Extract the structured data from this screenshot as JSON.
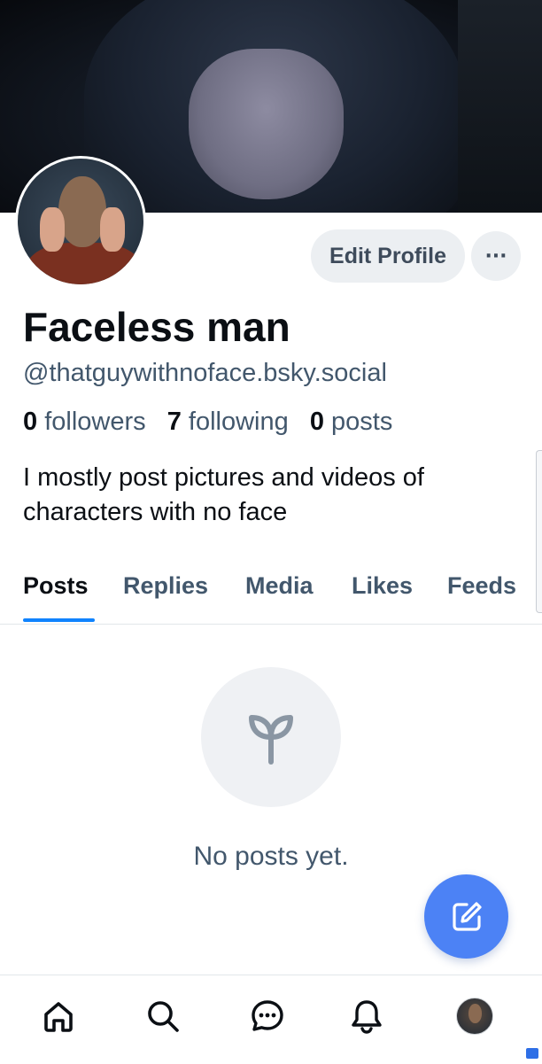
{
  "profile": {
    "display_name": "Faceless man",
    "handle": "@thatguywithnoface.bsky.social",
    "stats": {
      "followers_count": "0",
      "followers_label": "followers",
      "following_count": "7",
      "following_label": "following",
      "posts_count": "0",
      "posts_label": "posts"
    },
    "bio": "I mostly post pictures and videos of characters with no face"
  },
  "actions": {
    "edit_profile_label": "Edit Profile",
    "more_label": "···"
  },
  "tabs": [
    {
      "label": "Posts",
      "active": true
    },
    {
      "label": "Replies",
      "active": false
    },
    {
      "label": "Media",
      "active": false
    },
    {
      "label": "Likes",
      "active": false
    },
    {
      "label": "Feeds",
      "active": false
    }
  ],
  "empty_state": {
    "icon": "sprout-icon",
    "message": "No posts yet."
  },
  "fab": {
    "icon": "compose-icon"
  },
  "bottom_nav": [
    {
      "icon": "home-icon"
    },
    {
      "icon": "search-icon"
    },
    {
      "icon": "chat-icon"
    },
    {
      "icon": "bell-icon"
    },
    {
      "icon": "profile-avatar"
    }
  ],
  "colors": {
    "accent": "#1083fe",
    "fab": "#4c82f5",
    "muted_text": "#42576c",
    "button_bg": "#eceff2"
  }
}
